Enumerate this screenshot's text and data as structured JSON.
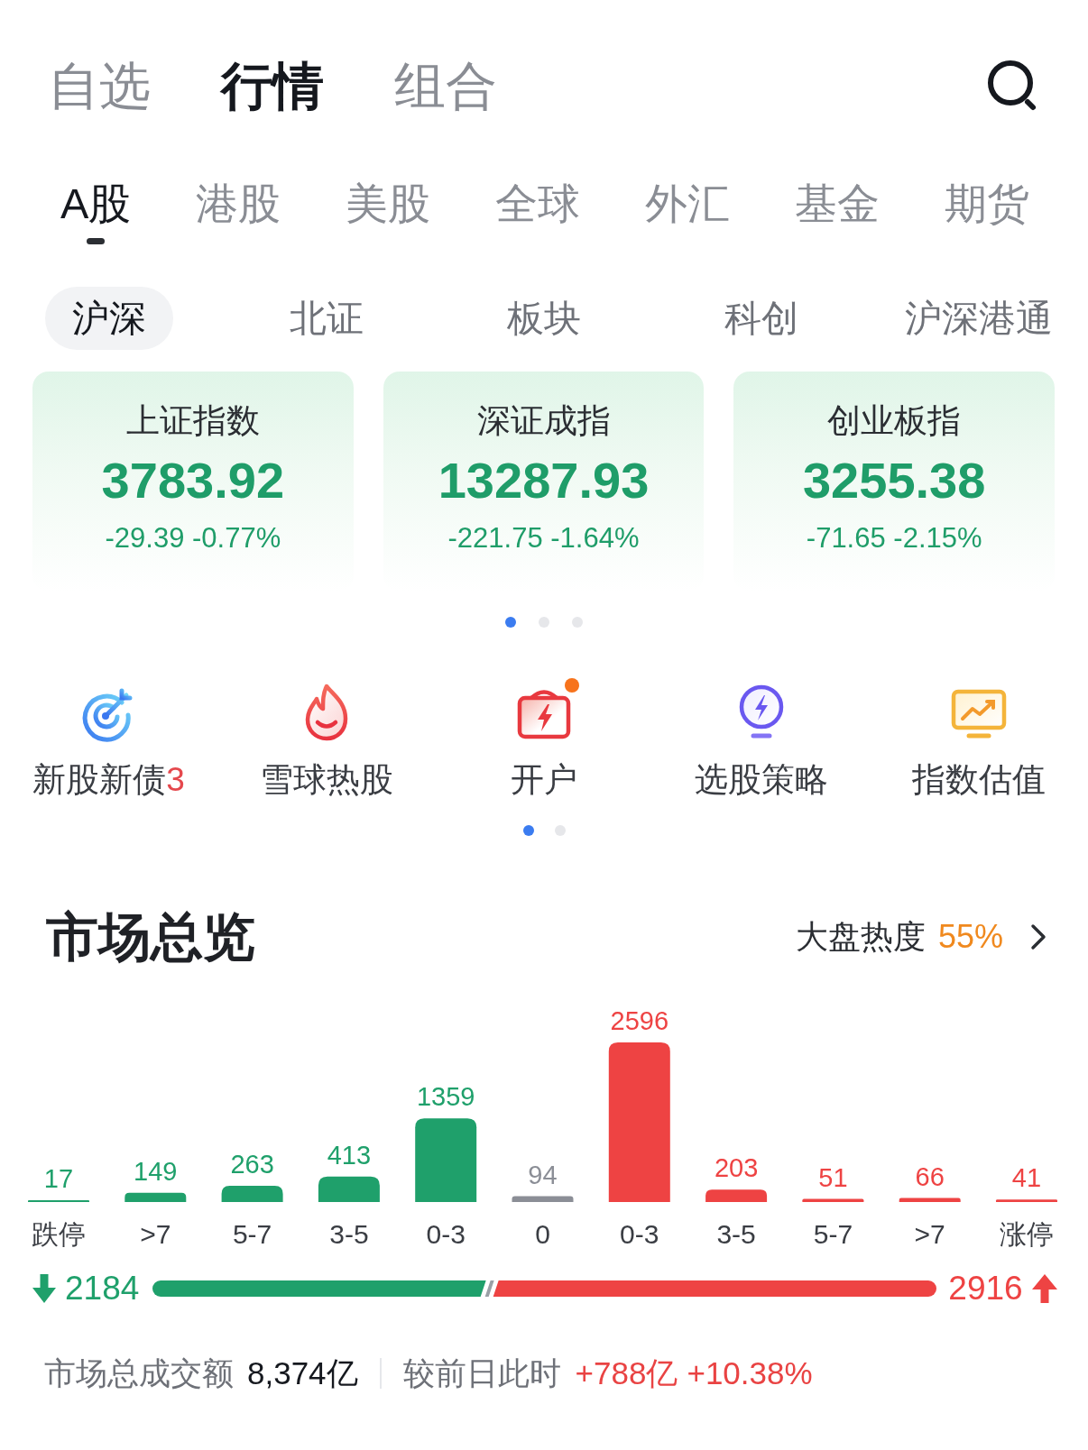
{
  "top_tabs": [
    {
      "label": "自选",
      "selected": false
    },
    {
      "label": "行情",
      "selected": true
    },
    {
      "label": "组合",
      "selected": false
    }
  ],
  "market_tabs": [
    {
      "label": "A股",
      "selected": true
    },
    {
      "label": "港股",
      "selected": false
    },
    {
      "label": "美股",
      "selected": false
    },
    {
      "label": "全球",
      "selected": false
    },
    {
      "label": "外汇",
      "selected": false
    },
    {
      "label": "基金",
      "selected": false
    },
    {
      "label": "期货",
      "selected": false
    }
  ],
  "sub_tabs": [
    {
      "label": "沪深",
      "selected": true
    },
    {
      "label": "北证",
      "selected": false
    },
    {
      "label": "板块",
      "selected": false
    },
    {
      "label": "科创",
      "selected": false
    },
    {
      "label": "沪深港通",
      "selected": false
    }
  ],
  "index_cards": [
    {
      "name": "上证指数",
      "value": "3783.92",
      "change": "-29.39 -0.77%"
    },
    {
      "name": "深证成指",
      "value": "13287.93",
      "change": "-221.75 -1.64%"
    },
    {
      "name": "创业板指",
      "value": "3255.38",
      "change": "-71.65 -2.15%"
    }
  ],
  "card_pages": [
    {
      "selected": true
    },
    {
      "selected": false
    },
    {
      "selected": false
    }
  ],
  "shortcuts": [
    {
      "label": "新股新债",
      "count": "3",
      "dot": false
    },
    {
      "label": "雪球热股",
      "dot": false
    },
    {
      "label": "开户",
      "dot": true
    },
    {
      "label": "选股策略",
      "dot": false
    },
    {
      "label": "指数估值",
      "dot": false
    }
  ],
  "shortcut_pages": [
    {
      "selected": true
    },
    {
      "selected": false
    }
  ],
  "market_overview": {
    "title": "市场总览",
    "heat_label": "大盘热度",
    "heat_value": "55%",
    "chart_data": {
      "type": "bar",
      "categories": [
        "跌停",
        ">7",
        "5-7",
        "3-5",
        "0-3",
        "0",
        "0-3",
        "3-5",
        "5-7",
        ">7",
        "涨停"
      ],
      "series": [
        {
          "color": "#1fa06b",
          "values": [
            17,
            149,
            263,
            413,
            1359,
            null,
            null,
            null,
            null,
            null,
            null
          ]
        },
        {
          "color": "#8b8e96",
          "values": [
            null,
            null,
            null,
            null,
            null,
            94,
            null,
            null,
            null,
            null,
            null
          ]
        },
        {
          "color": "#ee4343",
          "values": [
            null,
            null,
            null,
            null,
            null,
            null,
            2596,
            203,
            51,
            66,
            41
          ]
        }
      ],
      "stacked": true,
      "data_labels": true
    },
    "breadth": {
      "down_count": "2184",
      "up_count": "2916",
      "level": 0.43
    },
    "turnover": {
      "label": "市场总成交额",
      "value": "8,374亿",
      "compare_label": "较前日此时",
      "change": "+788亿",
      "change_pct": "+10.38%"
    }
  }
}
